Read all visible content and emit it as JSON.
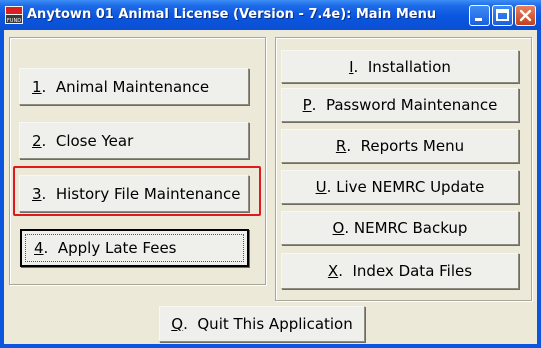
{
  "window": {
    "title": "Anytown 01 Animal License (Version - 7.4e):  Main Menu",
    "app_icon": "nemrc-fund-icon",
    "controls": [
      "minimize-icon",
      "maximize-icon",
      "close-icon"
    ]
  },
  "left_menu": [
    {
      "key": "1",
      "sep": ".",
      "label": "  Animal Maintenance"
    },
    {
      "key": "2",
      "sep": ".",
      "label": "  Close Year"
    },
    {
      "key": "3",
      "sep": ".",
      "label": "  History File Maintenance"
    },
    {
      "key": "4",
      "sep": ".",
      "label": "  Apply Late Fees"
    }
  ],
  "right_menu": [
    {
      "key": "I",
      "sep": ".",
      "label": "  Installation"
    },
    {
      "key": "P",
      "sep": ".",
      "label": "  Password Maintenance"
    },
    {
      "key": "R",
      "sep": ".",
      "label": "  Reports Menu"
    },
    {
      "key": "U",
      "sep": ".",
      "label": " Live NEMRC Update"
    },
    {
      "key": "O",
      "sep": ".",
      "label": " NEMRC Backup"
    },
    {
      "key": "X",
      "sep": ".",
      "label": "  Index Data Files"
    }
  ],
  "quit": {
    "key": "Q",
    "sep": ".",
    "label": "  Quit This Application"
  },
  "highlight_color": "#e0191f"
}
